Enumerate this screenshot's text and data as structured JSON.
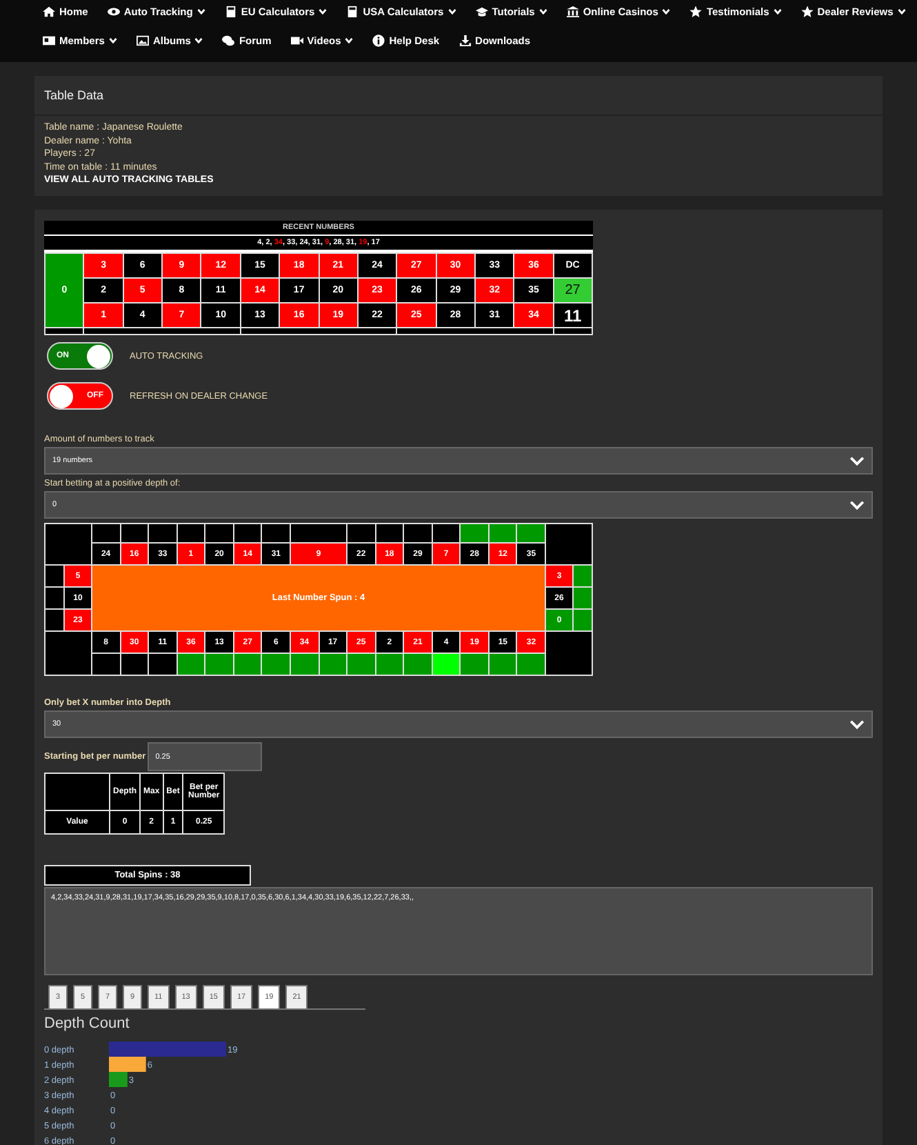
{
  "nav": [
    {
      "label": "Home",
      "has_menu": false
    },
    {
      "label": "Auto Tracking",
      "has_menu": true
    },
    {
      "label": "EU Calculators",
      "has_menu": true
    },
    {
      "label": "USA Calculators",
      "has_menu": true
    },
    {
      "label": "Tutorials",
      "has_menu": true
    },
    {
      "label": "Online Casinos",
      "has_menu": true
    },
    {
      "label": "Testimonials",
      "has_menu": true
    },
    {
      "label": "Dealer Reviews",
      "has_menu": true
    },
    {
      "label": "Members",
      "has_menu": true
    },
    {
      "label": "Albums",
      "has_menu": true
    },
    {
      "label": "Forum",
      "has_menu": false
    },
    {
      "label": "Videos",
      "has_menu": true
    },
    {
      "label": "Help Desk",
      "has_menu": false
    },
    {
      "label": "Downloads",
      "has_menu": false
    }
  ],
  "table_data": {
    "title": "Table Data",
    "lines": [
      "Table name : Japanese Roulette",
      "Dealer name : Yohta",
      "Players : 27",
      "Time on table : 11 minutes"
    ],
    "link": "VIEW ALL AUTO TRACKING TABLES"
  },
  "recent": {
    "title": "RECENT NUMBERS",
    "separator": ", ",
    "numbers": [
      {
        "n": "4",
        "color": "#ffffff"
      },
      {
        "n": "2",
        "color": "#ffffff"
      },
      {
        "n": "34",
        "color": "#ff0000"
      },
      {
        "n": "33",
        "color": "#ffffff"
      },
      {
        "n": "24",
        "color": "#ffffff"
      },
      {
        "n": "31",
        "color": "#ffffff"
      },
      {
        "n": "9",
        "color": "#ff0000"
      },
      {
        "n": "28",
        "color": "#ffffff"
      },
      {
        "n": "31",
        "color": "#ffffff"
      },
      {
        "n": "19",
        "color": "#ff0000"
      },
      {
        "n": "17",
        "color": "#ffffff"
      }
    ]
  },
  "board": {
    "zero": "0",
    "rows": [
      [
        {
          "n": "3",
          "color": "#ff0000"
        },
        {
          "n": "6",
          "color": "#000000"
        },
        {
          "n": "9",
          "color": "#ff0000"
        },
        {
          "n": "12",
          "color": "#ff0000"
        },
        {
          "n": "15",
          "color": "#000000"
        },
        {
          "n": "18",
          "color": "#ff0000"
        },
        {
          "n": "21",
          "color": "#ff0000"
        },
        {
          "n": "24",
          "color": "#000000"
        },
        {
          "n": "27",
          "color": "#ff0000"
        },
        {
          "n": "30",
          "color": "#ff0000"
        },
        {
          "n": "33",
          "color": "#000000"
        },
        {
          "n": "36",
          "color": "#ff0000"
        }
      ],
      [
        {
          "n": "2",
          "color": "#000000"
        },
        {
          "n": "5",
          "color": "#ff0000"
        },
        {
          "n": "8",
          "color": "#000000"
        },
        {
          "n": "11",
          "color": "#000000"
        },
        {
          "n": "14",
          "color": "#ff0000"
        },
        {
          "n": "17",
          "color": "#000000"
        },
        {
          "n": "20",
          "color": "#000000"
        },
        {
          "n": "23",
          "color": "#ff0000"
        },
        {
          "n": "26",
          "color": "#000000"
        },
        {
          "n": "29",
          "color": "#000000"
        },
        {
          "n": "32",
          "color": "#ff0000"
        },
        {
          "n": "35",
          "color": "#000000"
        }
      ],
      [
        {
          "n": "1",
          "color": "#ff0000"
        },
        {
          "n": "4",
          "color": "#000000"
        },
        {
          "n": "7",
          "color": "#ff0000"
        },
        {
          "n": "10",
          "color": "#000000"
        },
        {
          "n": "13",
          "color": "#000000"
        },
        {
          "n": "16",
          "color": "#ff0000"
        },
        {
          "n": "19",
          "color": "#ff0000"
        },
        {
          "n": "22",
          "color": "#000000"
        },
        {
          "n": "25",
          "color": "#ff0000"
        },
        {
          "n": "28",
          "color": "#000000"
        },
        {
          "n": "31",
          "color": "#000000"
        },
        {
          "n": "34",
          "color": "#ff0000"
        }
      ]
    ],
    "dealer": {
      "label": "DC",
      "count": "27",
      "count_highlight": true,
      "total": "11"
    }
  },
  "toggles": [
    {
      "state_label": "ON",
      "on": true,
      "label": "AUTO TRACKING"
    },
    {
      "state_label": "OFF",
      "on": false,
      "label": "REFRESH ON DEALER CHANGE"
    }
  ],
  "selects": [
    {
      "label": "Amount of numbers to track",
      "value": "19 numbers"
    },
    {
      "label": "Start betting at a positive depth of:",
      "value": "0"
    }
  ],
  "racetrack": {
    "center": "Last Number Spun : 4",
    "top": [
      {
        "n": "24",
        "color": "#000000",
        "marker": {
          "color": "#000000"
        }
      },
      {
        "n": "16",
        "color": "#ff0000",
        "marker": {
          "color": "#000000"
        }
      },
      {
        "n": "33",
        "color": "#000000",
        "marker": {
          "color": "#000000"
        }
      },
      {
        "n": "1",
        "color": "#ff0000",
        "marker": {
          "color": "#000000"
        }
      },
      {
        "n": "20",
        "color": "#000000",
        "marker": {
          "color": "#000000"
        }
      },
      {
        "n": "14",
        "color": "#ff0000",
        "marker": {
          "color": "#000000"
        }
      },
      {
        "n": "31",
        "color": "#000000",
        "marker": {
          "color": "#000000"
        }
      },
      {
        "n": "9",
        "color": "#ff0000",
        "marker": {
          "color": "#000000"
        }
      },
      {
        "n": "22",
        "color": "#000000",
        "marker": {
          "color": "#000000"
        }
      },
      {
        "n": "18",
        "color": "#ff0000",
        "marker": {
          "color": "#000000"
        }
      },
      {
        "n": "29",
        "color": "#000000",
        "marker": {
          "color": "#000000"
        }
      },
      {
        "n": "7",
        "color": "#ff0000",
        "marker": {
          "color": "#000000"
        }
      },
      {
        "n": "28",
        "color": "#000000",
        "marker": {
          "color": "#009900"
        }
      },
      {
        "n": "12",
        "color": "#ff0000",
        "marker": {
          "color": "#009900"
        }
      },
      {
        "n": "35",
        "color": "#000000",
        "marker": {
          "color": "#009900"
        }
      }
    ],
    "left": [
      {
        "n": "5",
        "color": "#ff0000",
        "marker": {
          "color": "#000000"
        }
      },
      {
        "n": "10",
        "color": "#000000",
        "marker": {
          "color": "#000000"
        }
      },
      {
        "n": "23",
        "color": "#ff0000",
        "marker": {
          "color": "#000000"
        }
      }
    ],
    "right": [
      {
        "n": "3",
        "color": "#ff0000",
        "marker": {
          "color": "#009900"
        }
      },
      {
        "n": "26",
        "color": "#000000",
        "marker": {
          "color": "#009900"
        }
      },
      {
        "n": "0",
        "color": "#009900",
        "marker": {
          "color": "#009900"
        }
      }
    ],
    "bottom": [
      {
        "n": "8",
        "color": "#000000",
        "marker": {
          "color": "#000000"
        }
      },
      {
        "n": "30",
        "color": "#ff0000",
        "marker": {
          "color": "#000000"
        }
      },
      {
        "n": "11",
        "color": "#000000",
        "marker": {
          "color": "#000000"
        }
      },
      {
        "n": "36",
        "color": "#ff0000",
        "marker": {
          "color": "#009900"
        }
      },
      {
        "n": "13",
        "color": "#000000",
        "marker": {
          "color": "#009900"
        }
      },
      {
        "n": "27",
        "color": "#ff0000",
        "marker": {
          "color": "#009900"
        }
      },
      {
        "n": "6",
        "color": "#000000",
        "marker": {
          "color": "#009900"
        }
      },
      {
        "n": "34",
        "color": "#ff0000",
        "marker": {
          "color": "#009900"
        }
      },
      {
        "n": "17",
        "color": "#000000",
        "marker": {
          "color": "#009900"
        }
      },
      {
        "n": "25",
        "color": "#ff0000",
        "marker": {
          "color": "#009900"
        }
      },
      {
        "n": "2",
        "color": "#000000",
        "marker": {
          "color": "#009900"
        }
      },
      {
        "n": "21",
        "color": "#ff0000",
        "marker": {
          "color": "#009900"
        }
      },
      {
        "n": "4",
        "color": "#000000",
        "marker": {
          "color": "#00ff00"
        }
      },
      {
        "n": "19",
        "color": "#ff0000",
        "marker": {
          "color": "#009900"
        }
      },
      {
        "n": "15",
        "color": "#000000",
        "marker": {
          "color": "#009900"
        }
      },
      {
        "n": "32",
        "color": "#ff0000",
        "marker": {
          "color": "#009900"
        }
      }
    ]
  },
  "depth_select": {
    "label": "Only bet X number into Depth",
    "value": "30"
  },
  "starting_bet": {
    "label": "Starting bet per number",
    "value": "0.25"
  },
  "bet_table": {
    "columns": [
      "",
      "Depth",
      "Max",
      "Bet",
      "Bet per Number"
    ],
    "rows": [
      [
        "Value",
        "0",
        "2",
        "1",
        "0.25"
      ]
    ]
  },
  "total_spins": "Total Spins : 38",
  "history": "4,2,34,33,24,31,9,28,31,19,17,34,35,16,29,29,35,9,10,8,17,0,35,6,30,6,1,34,4,30,33,19,6,35,12,22,7,26,33,,",
  "tabs": [
    {
      "label": "3",
      "selected": false
    },
    {
      "label": "5",
      "selected": false
    },
    {
      "label": "7",
      "selected": false
    },
    {
      "label": "9",
      "selected": false
    },
    {
      "label": "11",
      "selected": false
    },
    {
      "label": "13",
      "selected": false
    },
    {
      "label": "15",
      "selected": false
    },
    {
      "label": "17",
      "selected": false
    },
    {
      "label": "19",
      "selected": true
    },
    {
      "label": "21",
      "selected": false
    }
  ],
  "depth_count": {
    "title": "Depth Count",
    "chart_data": {
      "type": "bar",
      "orientation": "horizontal",
      "categories": [
        "0 depth",
        "1 depth",
        "2 depth",
        "3 depth",
        "4 depth",
        "5 depth",
        "6 depth"
      ],
      "values": [
        19,
        6,
        3,
        0,
        0,
        0,
        0
      ],
      "data_labels": true
    }
  }
}
